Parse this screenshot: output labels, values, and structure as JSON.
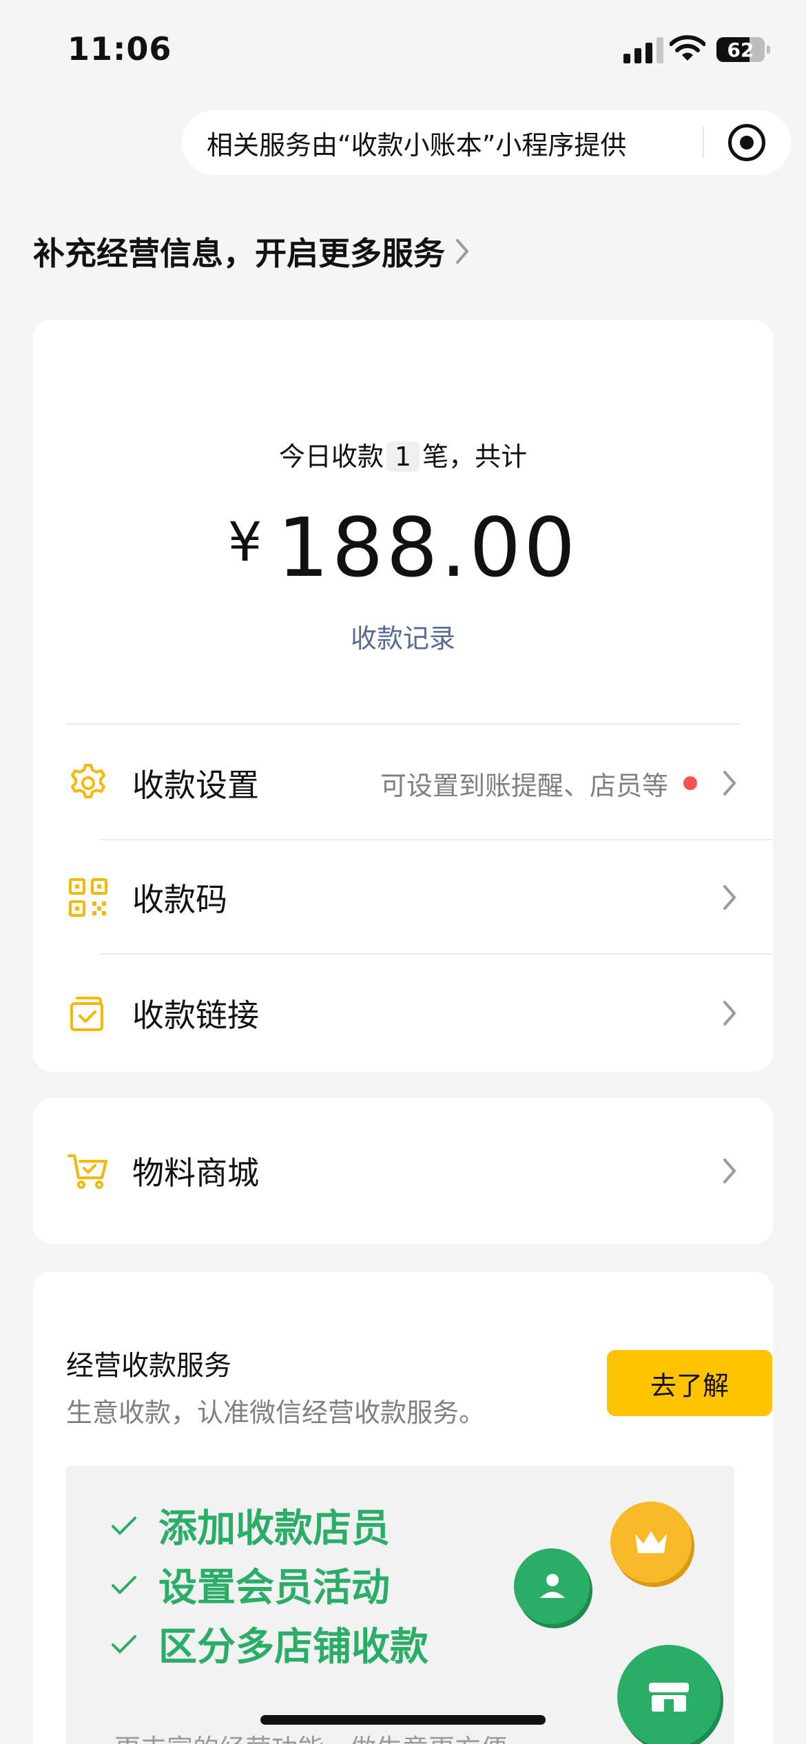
{
  "status": {
    "time": "11:06",
    "battery": "62"
  },
  "mini_program": {
    "notice": "相关服务由“收款小账本”小程序提供"
  },
  "header": {
    "title": "补充经营信息，开启更多服务"
  },
  "summary": {
    "prefix": "今日收款",
    "count": "1",
    "suffix": "笔，共计",
    "currency": "¥",
    "amount": "188.00",
    "records_link": "收款记录"
  },
  "menu": [
    {
      "label": "收款设置",
      "hint": "可设置到账提醒、店员等",
      "icon": "gear-icon",
      "has_dot": true
    },
    {
      "label": "收款码",
      "hint": "",
      "icon": "qrcode-icon",
      "has_dot": false
    },
    {
      "label": "收款链接",
      "hint": "",
      "icon": "link-icon",
      "has_dot": false
    }
  ],
  "store": {
    "label": "物料商城",
    "icon": "cart-icon"
  },
  "service": {
    "title": "经营收款服务",
    "subtitle": "生意收款，认准微信经营收款服务。",
    "button": "去了解",
    "features": [
      "添加收款店员",
      "设置会员活动",
      "区分多店铺收款"
    ],
    "note": "更丰富的经营功能，做生意更方便"
  },
  "colors": {
    "accent_yellow": "#ffc300",
    "green": "#2aae67",
    "link_blue": "#576b95",
    "red_dot": "#fa5151"
  }
}
